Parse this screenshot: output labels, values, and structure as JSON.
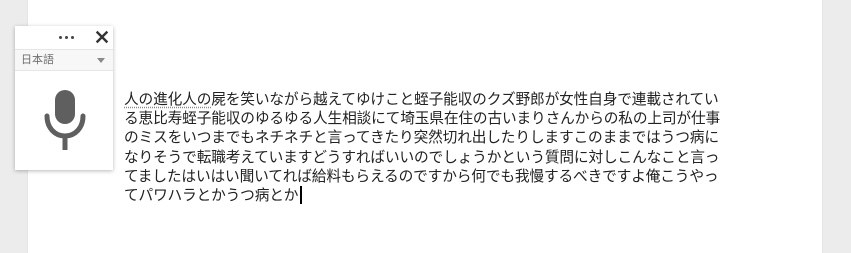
{
  "document": {
    "text_lines": [
      "人の進化人の屍を笑いながら越えてゆけこと蛭子能収のクズ野郎が女性自身で連載されてい",
      "る恵比寿蛭子能収のゆるゆる人生相談にて埼玉県在住の古いまりさんからの私の上司が仕事",
      "のミスをいつまでもネチネチと言ってきたり突然切れ出したりしますこのままではうつ病に",
      "なりそうで転職考えていますどうすればいいのでしょうかという質問に対しこんなこと言っ",
      "てましたはいはい聞いてれば給料もらえるのですから何でも我慢するべきですよ俺こうやっ",
      "てパワハラとかうつ病とか"
    ],
    "underlined_prefix": "人の進化人の"
  },
  "voice_widget": {
    "more_icon": "more-horiz-icon",
    "close_icon": "close-icon",
    "language": "日本語",
    "mic_icon": "microphone-icon",
    "mic_color": "#5f5f5f"
  },
  "colors": {
    "background": "#ececec",
    "page": "#ffffff",
    "text": "#222222"
  }
}
